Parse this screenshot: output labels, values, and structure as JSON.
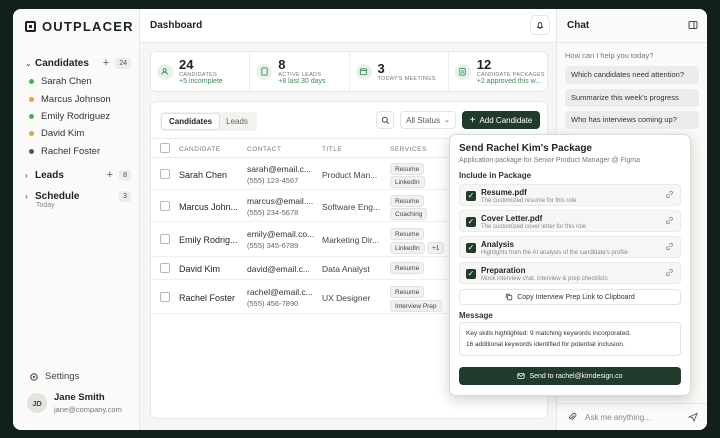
{
  "brand": {
    "name": "OUTPLACER"
  },
  "sidebar": {
    "candidates": {
      "label": "Candidates",
      "count": "24",
      "items": [
        {
          "label": "Sarah Chen",
          "color": "#4caf50"
        },
        {
          "label": "Marcus Johnson",
          "color": "#e5a33b"
        },
        {
          "label": "Emily Rodriguez",
          "color": "#4caf50"
        },
        {
          "label": "David Kim",
          "color": "#e5a33b"
        },
        {
          "label": "Rachel Foster",
          "color": "#555555"
        }
      ]
    },
    "leads": {
      "label": "Leads",
      "count": "8"
    },
    "schedule": {
      "label": "Schedule",
      "sub": "Today",
      "count": "3"
    },
    "settings_label": "Settings",
    "user": {
      "initials": "JD",
      "name": "Jane Smith",
      "email": "jane@company.com"
    }
  },
  "header": {
    "title": "Dashboard"
  },
  "stats": [
    {
      "value": "24",
      "label": "CANDIDATES",
      "sub": "+5 incomplete",
      "icon": "users-icon"
    },
    {
      "value": "8",
      "label": "ACTIVE LEADS",
      "sub": "+8 last 30 days",
      "icon": "document-icon"
    },
    {
      "value": "3",
      "label": "TODAY'S MEETINGS",
      "sub": "",
      "icon": "calendar-icon"
    },
    {
      "value": "12",
      "label": "CANDIDATE PACKAGES",
      "sub": "+2 approved this w...",
      "icon": "clipboard-icon"
    }
  ],
  "table": {
    "tabs": [
      "Candidates",
      "Leads"
    ],
    "status_filter": "All Status",
    "add_button": "Add Candidate",
    "columns": [
      "CANDIDATE",
      "CONTACT",
      "TITLE",
      "SERVICES"
    ],
    "rows": [
      {
        "name": "Sarah Chen",
        "email": "sarah@email.c...",
        "phone": "(555) 123-4567",
        "title": "Product Man...",
        "services": [
          "Resume",
          "LinkedIn"
        ],
        "extra": ""
      },
      {
        "name": "Marcus John...",
        "email": "marcus@email....",
        "phone": "(555) 234-5678",
        "title": "Software Eng...",
        "services": [
          "Resume",
          "Coaching"
        ],
        "extra": ""
      },
      {
        "name": "Emily Rodrig...",
        "email": "emily@email.co...",
        "phone": "(555) 345-6789",
        "title": "Marketing Dir...",
        "services": [
          "Resume",
          "LinkedIn"
        ],
        "extra": "+1"
      },
      {
        "name": "David Kim",
        "email": "david@email.c...",
        "phone": "",
        "title": "Data Analyst",
        "services": [
          "Resume"
        ],
        "extra": ""
      },
      {
        "name": "Rachel Foster",
        "email": "rachel@email.c...",
        "phone": "(555) 456-7890",
        "title": "UX Designer",
        "services": [
          "Resume",
          "Interview Prep"
        ],
        "extra": ""
      }
    ]
  },
  "package": {
    "title": "Send Rachel Kim's Package",
    "subtitle": "Application package for Senior Product Manager @ Figma",
    "include_label": "Include in Package",
    "items": [
      {
        "title": "Resume.pdf",
        "desc": "The customized resume for this role"
      },
      {
        "title": "Cover Letter.pdf",
        "desc": "The customized cover letter for this role"
      },
      {
        "title": "Analysis",
        "desc": "Highlights from the AI analysis of the candidate's profile"
      },
      {
        "title": "Preparation",
        "desc": "Mock interview chat, interview & prep checklists"
      }
    ],
    "copy_button": "Copy Interview Prep Link to Clipboard",
    "message_label": "Message",
    "message_lines": [
      "Key skills highlighted: 9 matching keywords incorporated.",
      "16 additional keywords identified for potential inclusion."
    ],
    "send_button": "Send to rachel@kimdesign.co"
  },
  "chat": {
    "title": "Chat",
    "hint": "How can I help you today?",
    "suggestions": [
      "Which candidates need attention?",
      "Summarize this week's progress",
      "Who has interviews coming up?"
    ],
    "placeholder": "Ask me anything..."
  },
  "colors": {
    "accent": "#203a2c",
    "positive": "#3c8a58",
    "background": "#11201a"
  }
}
